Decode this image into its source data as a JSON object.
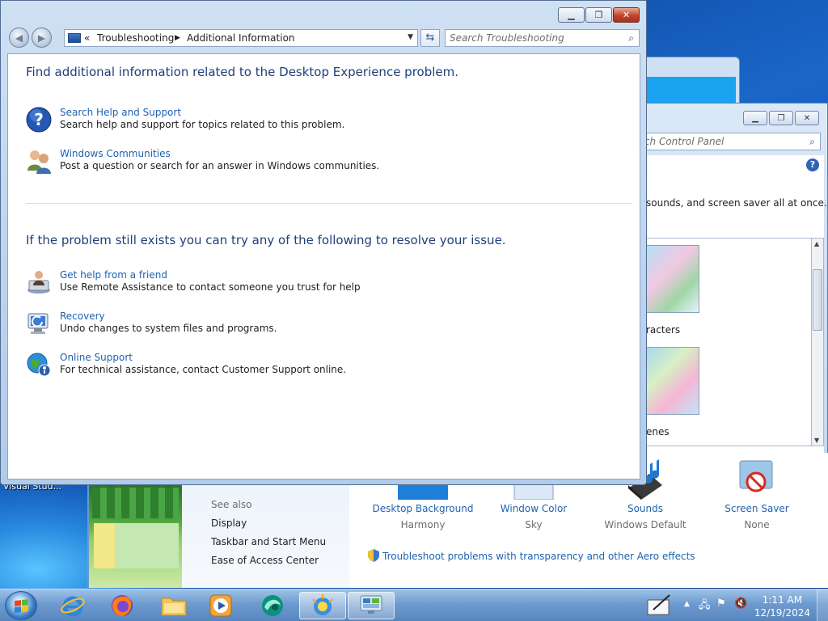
{
  "desktop": {
    "label": "Visual Stud..."
  },
  "troubleshoot_window": {
    "breadcrumb": {
      "overflow": "«",
      "items": [
        "Troubleshooting",
        "Additional Information"
      ]
    },
    "search_placeholder": "Search Troubleshooting",
    "heading_1": "Find additional information related to the Desktop Experience problem.",
    "options_top": [
      {
        "link": "Search Help and Support",
        "desc": "Search help and support for topics related to this problem.",
        "icon": "help-icon"
      },
      {
        "link": "Windows Communities",
        "desc": "Post a question or search for an answer in Windows communities.",
        "icon": "community-icon"
      }
    ],
    "heading_2": "If the problem still exists you can try any of the following to resolve your issue.",
    "options_bottom": [
      {
        "link": "Get help from a friend",
        "desc": "Use Remote Assistance to contact someone you trust for help",
        "icon": "remote-assistance-icon"
      },
      {
        "link": "Recovery",
        "desc": "Undo changes to system files and programs.",
        "icon": "recovery-icon"
      },
      {
        "link": "Online Support",
        "desc": "For technical assistance, contact Customer Support online.",
        "icon": "online-support-icon"
      }
    ]
  },
  "control_panel": {
    "search_placeholder": "rch Control Panel",
    "description": "sounds, and screen saver all at once.",
    "themes": [
      "racters",
      "enes"
    ],
    "see_also": {
      "heading": "See also",
      "links": [
        "Display",
        "Taskbar and Start Menu",
        "Ease of Access Center"
      ]
    },
    "items": [
      {
        "name": "Desktop Background",
        "value": "Harmony",
        "icon": "desktop-background-icon"
      },
      {
        "name": "Window Color",
        "value": "Sky",
        "icon": "window-color-icon"
      },
      {
        "name": "Sounds",
        "value": "Windows Default",
        "icon": "sounds-icon"
      },
      {
        "name": "Screen Saver",
        "value": "None",
        "icon": "screen-saver-icon"
      }
    ],
    "aero_link": "Troubleshoot problems with transparency and other Aero effects"
  },
  "taskbar": {
    "time": "1:11 AM",
    "date": "12/19/2024"
  },
  "colors": {
    "link": "#1f62b0",
    "heading": "#1e3f78",
    "close_button": "#c4432c"
  }
}
